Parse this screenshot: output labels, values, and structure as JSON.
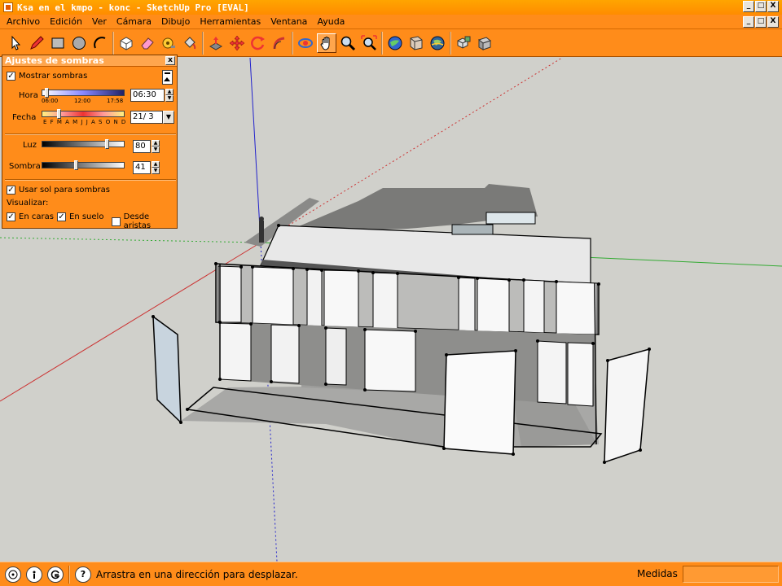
{
  "window": {
    "title": "Ksa en el kmpo - konc - SketchUp Pro [EVAL]",
    "buttons": [
      "_",
      "□",
      "X"
    ]
  },
  "menu": {
    "items": [
      "Archivo",
      "Edición",
      "Ver",
      "Cámara",
      "Dibujo",
      "Herramientas",
      "Ventana",
      "Ayuda"
    ],
    "mdi_buttons": [
      "_",
      "□",
      "X"
    ]
  },
  "toolbar": {
    "tools": [
      "select-icon",
      "pencil-icon",
      "rectangle-icon",
      "circle-icon",
      "arc-icon",
      "make-component-icon",
      "eraser-icon",
      "tape-measure-icon",
      "paint-bucket-icon",
      "push-pull-icon",
      "move-icon",
      "rotate-icon",
      "follow-me-icon",
      "orbit-icon",
      "pan-icon",
      "zoom-icon",
      "zoom-extents-icon",
      "get-models-icon",
      "share-model-icon",
      "google-earth-icon",
      "components-icon",
      "materials-icon"
    ],
    "active_tool": "pan-icon"
  },
  "shadow_dialog": {
    "title": "Ajustes de sombras",
    "close": "x",
    "show_shadows_label": "Mostrar sombras",
    "show_shadows_checked": true,
    "time": {
      "label": "Hora",
      "value": "06:30",
      "ticks": [
        "06:00",
        "12:00",
        "17:58"
      ],
      "level": 0.04
    },
    "date": {
      "label": "Fecha",
      "value": "21/ 3",
      "months": "E F M A M J J A S O N D",
      "level": 0.2
    },
    "light": {
      "label": "Luz",
      "value": "80",
      "level": 0.8
    },
    "shadow": {
      "label": "Sombra",
      "value": "41",
      "level": 0.41
    },
    "use_sun_label": "Usar sol para sombras",
    "use_sun_checked": true,
    "display_label": "Visualizar:",
    "on_faces_label": "En caras",
    "on_faces_checked": true,
    "on_ground_label": "En suelo",
    "on_ground_checked": true,
    "from_edges_label": "Desde aristas",
    "from_edges_checked": false
  },
  "statusbar": {
    "icons": [
      "geolocation-icon",
      "credits-icon",
      "google-icon",
      "help-icon"
    ],
    "message": "Arrastra en una dirección para desplazar.",
    "measure_label": "Medidas",
    "measure_value": ""
  },
  "colors": {
    "chrome_orange": "#ff8c1a",
    "viewport_bg": "#d0d0cb",
    "axis_red": "#cc3333",
    "axis_green": "#33aa33",
    "axis_blue": "#2222cc"
  }
}
